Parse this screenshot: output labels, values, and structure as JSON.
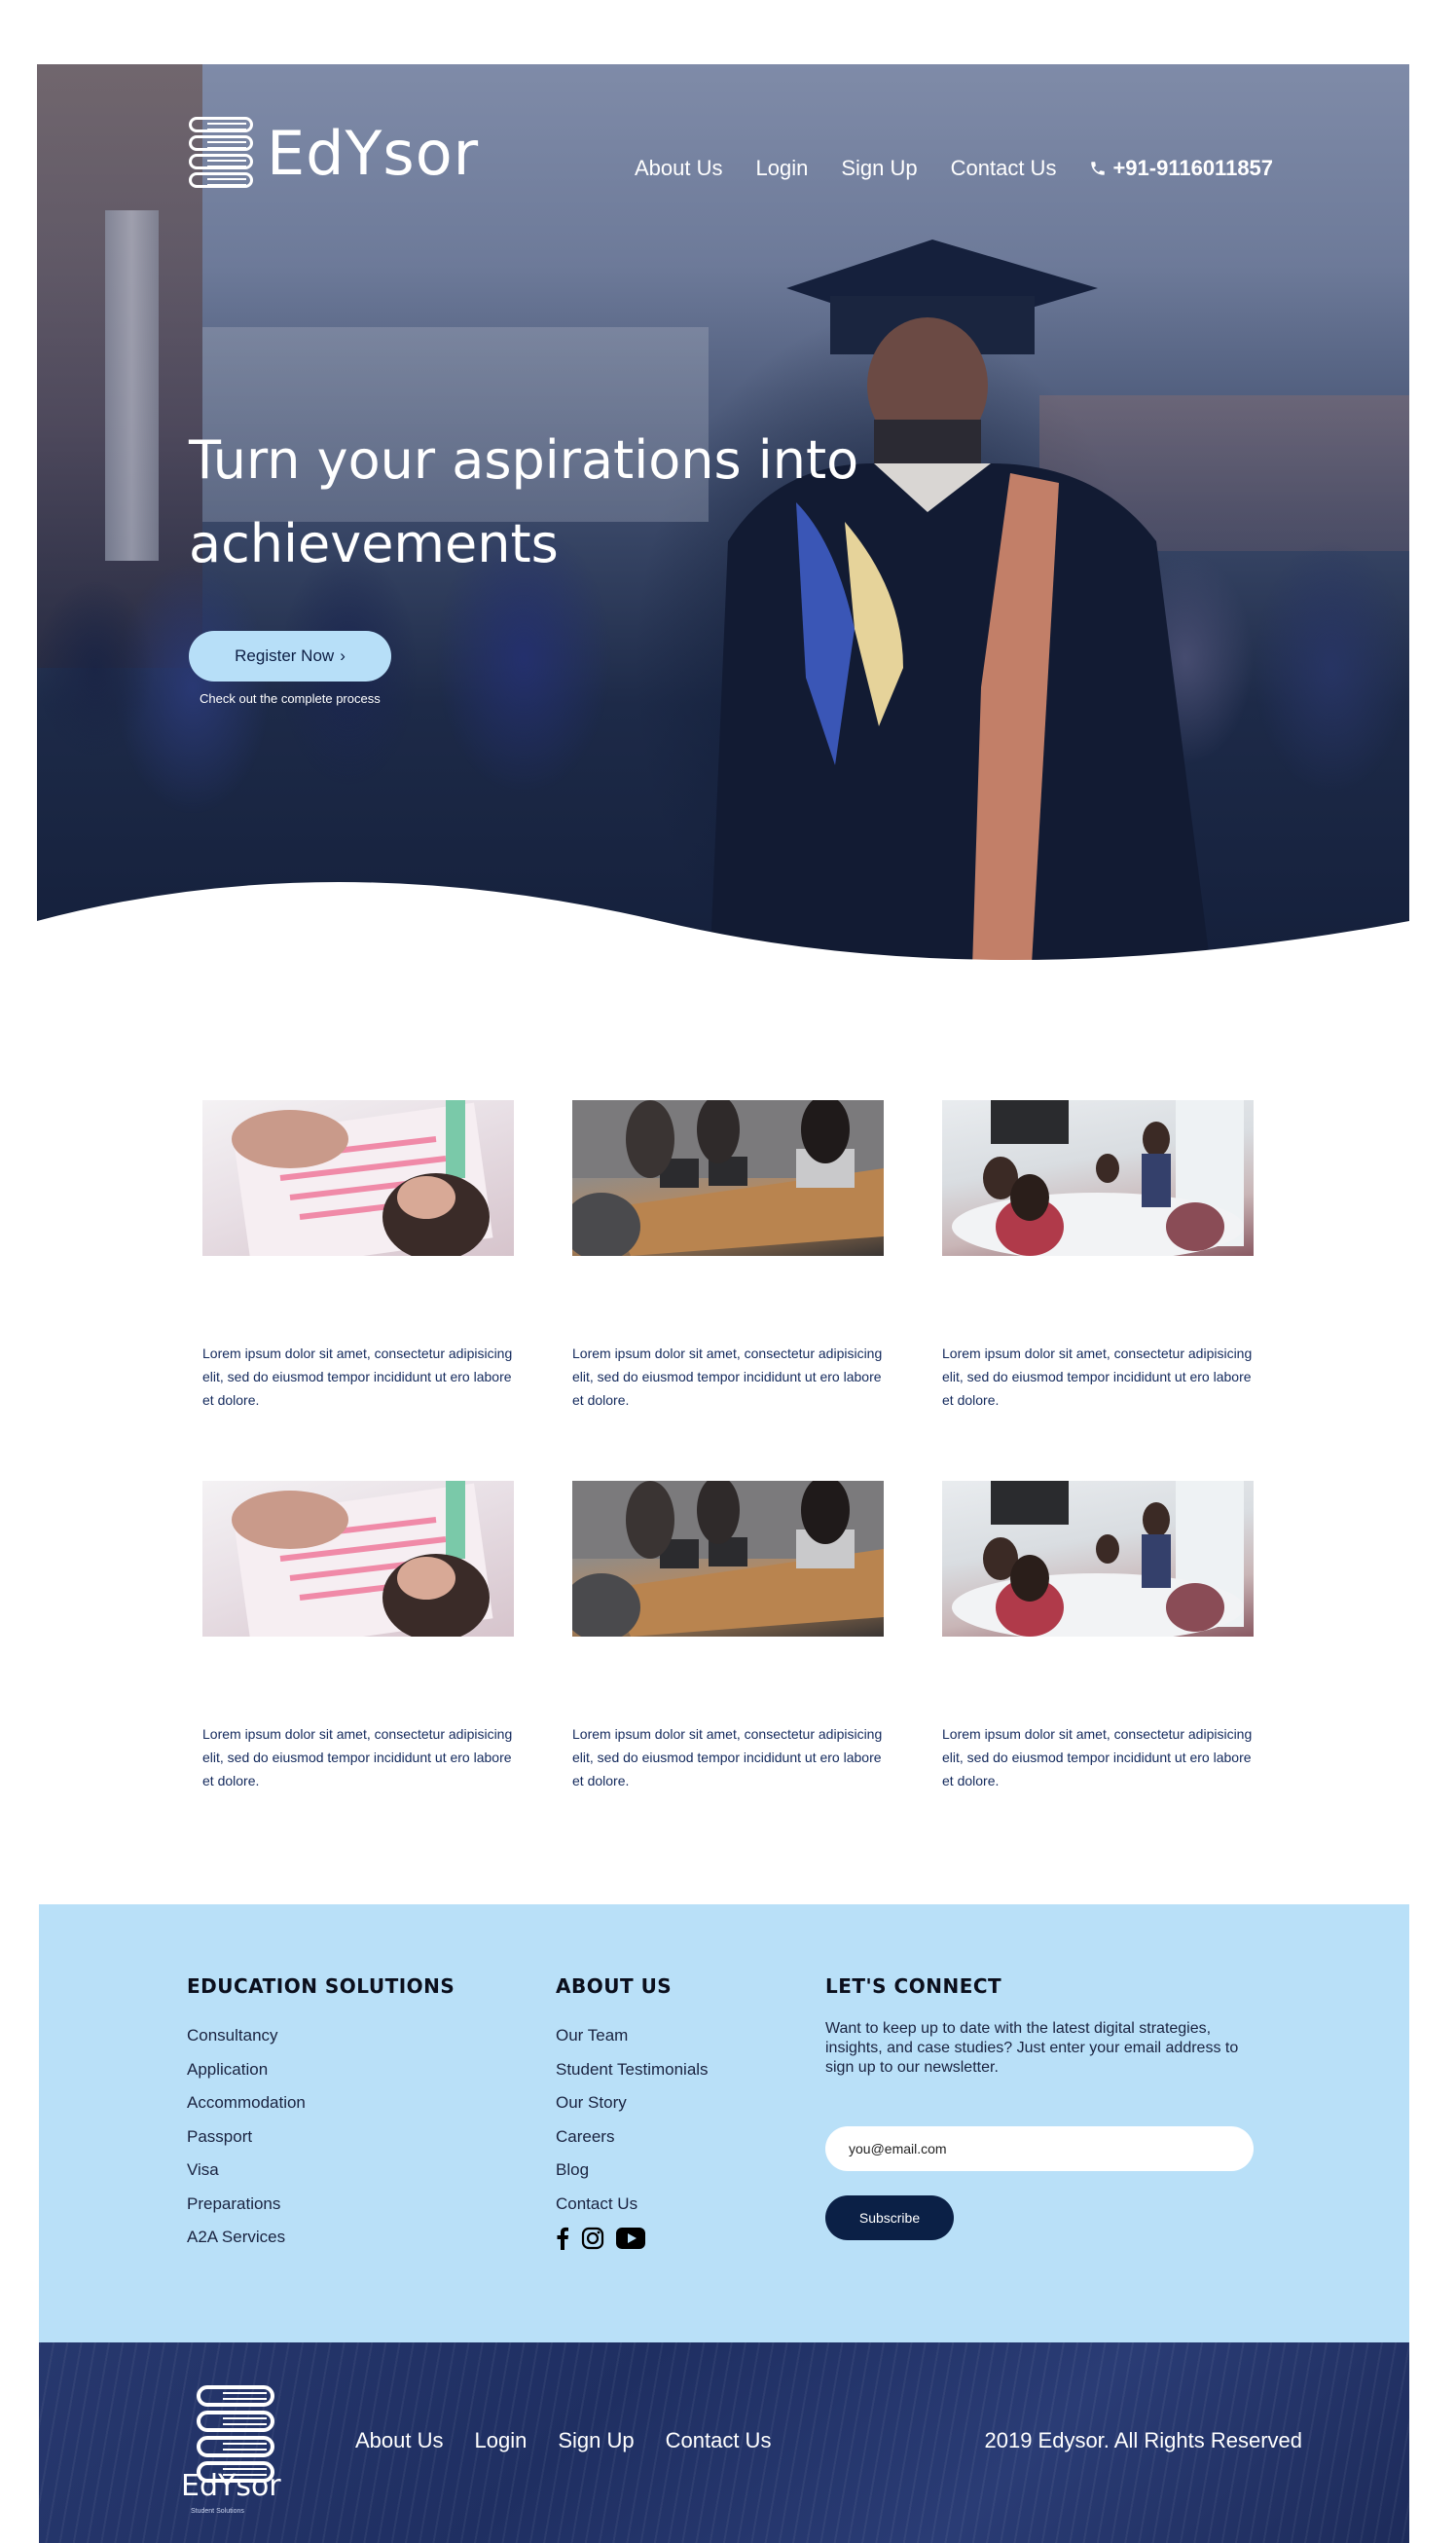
{
  "brand": {
    "name": "EdYsor",
    "tagline": "Student Solutions"
  },
  "header": {
    "nav": [
      "About Us",
      "Login",
      "Sign Up",
      "Contact Us"
    ],
    "phone": "+91-9116011857"
  },
  "hero": {
    "title": "Turn your aspirations into achievements",
    "cta_label": "Register Now",
    "cta_icon": "chevron-right-icon",
    "sub_text": "Check out the complete process"
  },
  "cards": [
    {
      "image": "notes-photo",
      "text": "Lorem ipsum dolor sit amet, consectetur adipisicing elit, sed do eiusmod tempor incididunt ut ero labore et dolore."
    },
    {
      "image": "meeting-photo",
      "text": "Lorem ipsum dolor sit amet, consectetur adipisicing elit, sed do eiusmod tempor incididunt ut ero labore et dolore."
    },
    {
      "image": "classroom-photo",
      "text": "Lorem ipsum dolor sit amet, consectetur adipisicing elit, sed do eiusmod tempor incididunt ut ero labore et dolore."
    },
    {
      "image": "notes-photo",
      "text": "Lorem ipsum dolor sit amet, consectetur adipisicing elit, sed do eiusmod tempor incididunt ut ero labore et dolore."
    },
    {
      "image": "meeting-photo",
      "text": "Lorem ipsum dolor sit amet, consectetur adipisicing elit, sed do eiusmod tempor incididunt ut ero labore et dolore."
    },
    {
      "image": "classroom-photo",
      "text": "Lorem ipsum dolor sit amet, consectetur adipisicing elit, sed do eiusmod tempor incididunt ut ero labore et dolore."
    }
  ],
  "footer": {
    "education": {
      "title": "EDUCATION SOLUTIONS",
      "items": [
        "Consultancy",
        "Application",
        "Accommodation",
        "Passport",
        "Visa",
        "Preparations",
        "A2A Services"
      ]
    },
    "about": {
      "title": "ABOUT US",
      "items": [
        "Our Team",
        "Student Testimonials",
        "Our Story",
        "Careers",
        "Blog",
        "Contact Us"
      ],
      "social": [
        "facebook-icon",
        "instagram-icon",
        "youtube-icon"
      ]
    },
    "connect": {
      "title": "LET'S CONNECT",
      "text": "Want to keep up to date with the latest digital strategies, insights, and case studies? Just enter your email address to sign up to our newsletter.",
      "email_placeholder": "you@email.com",
      "subscribe_label": "Subscribe"
    },
    "bottom": {
      "nav": [
        "About Us",
        "Login",
        "Sign Up",
        "Contact Us"
      ],
      "copyright": "2019 Edysor. All Rights Reserved"
    }
  },
  "colors": {
    "accent_light": "#b9e0f8",
    "navy": "#0b2046",
    "text_blue": "#13295c"
  }
}
